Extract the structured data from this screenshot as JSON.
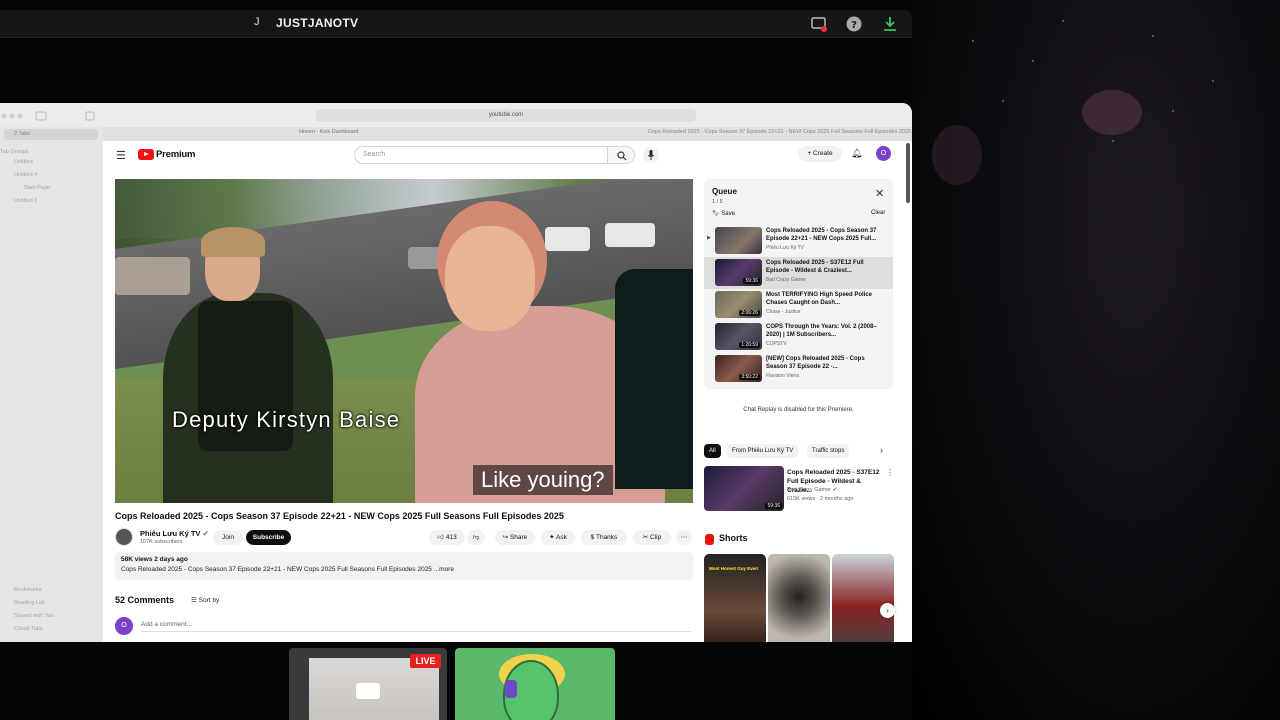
{
  "topbar": {
    "avatar_letter": "J",
    "channel_name": "JUSTJANOTV"
  },
  "browser": {
    "url": "youtube.com",
    "tab1": "Hoven - Kick Dashboard",
    "tab2": "Cops Reloaded 2025 - Cops Season 37 Episode 22+21 - NEW Cops 2025 Full Seasons Full Episodes 2025",
    "sidebar": {
      "tabs_label": "2 Tabs",
      "group_label": "Tab Groups",
      "items": [
        "Untitled",
        "Untitled 4",
        "Start Page",
        "Untitled 3"
      ],
      "bottom": [
        "Bookmarks",
        "Reading List",
        "Shared with You",
        "iCloud Tabs"
      ]
    }
  },
  "youtube": {
    "brand": "Premium",
    "search_placeholder": "Search",
    "create_label": "Create",
    "user_initial": "O",
    "video": {
      "caption_name": "Deputy Kirstyn Baise",
      "caption_cc": "Like youing?",
      "title": "Cops Reloaded 2025 - Cops Season 37 Episode 22+21 - NEW Cops 2025 Full Seasons Full Episodes 2025",
      "channel": "Phiêu Lưu Ký TV",
      "subscribers": "107K subscribers",
      "join": "Join",
      "subscribe": "Subscribe",
      "likes": "413",
      "share": "Share",
      "ask": "Ask",
      "thanks": "Thanks",
      "clip": "Clip",
      "views_date": "58K views  2 days ago",
      "description": "Cops Reloaded 2025 - Cops Season 37 Episode 22+21 - NEW Cops 2025 Full Seasons Full Episodes 2025 ...more"
    },
    "comments": {
      "count": "52 Comments",
      "sort": "Sort by",
      "placeholder": "Add a comment..."
    },
    "queue": {
      "title": "Queue",
      "count": "1 / 5",
      "save": "Save",
      "clear": "Clear",
      "items": [
        {
          "title": "Cops Reloaded 2025 - Cops Season 37 Episode 22+21 - NEW Cops 2025 Full...",
          "channel": "Phiêu Lưu Ký TV",
          "duration": ""
        },
        {
          "title": "Cops Reloaded 2025 - S37E12 Full Episode - Wildest & Craziest...",
          "channel": "Bad Crazy Gamer",
          "duration": "59:36"
        },
        {
          "title": "Most TERRIFYING High Speed Police Chases Caught on Dash...",
          "channel": "Chase - Justice",
          "duration": "2:06:26"
        },
        {
          "title": "COPS Through the Years: Vol. 2 (2008–2020) | 1M Subscribers...",
          "channel": "COPSTV",
          "duration": "1:26:59"
        },
        {
          "title": "[NEW] Cops Reloaded 2025 - Cops Season 37 Episode 22 -...",
          "channel": "Flaviano Vieira",
          "duration": "3:50:22"
        }
      ]
    },
    "chat_replay": "Chat Replay is disabled for this Premiere.",
    "chips": [
      "All",
      "From Phiêu Lưu Ký TV",
      "Traffic stops"
    ],
    "recommended": {
      "title": "Cops Reloaded 2025 - S37E12 Full Episode - Wildest & Crazie...",
      "channel": "Bad Crazy Gamer",
      "views": "615K views · 2 months ago",
      "duration": "59:36"
    },
    "shorts": {
      "label": "Shorts",
      "caption1": "Most Honest Guy Ever!"
    }
  },
  "bottom": {
    "live_label": "LIVE"
  }
}
